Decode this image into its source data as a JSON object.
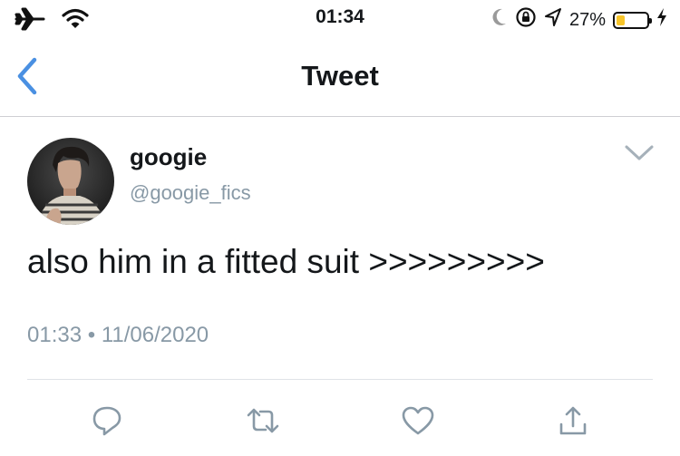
{
  "status_bar": {
    "time": "01:34",
    "battery_percent_label": "27%",
    "battery_level": 0.27,
    "battery_color": "#f7c52a",
    "icons": [
      "airplane-icon",
      "wifi-icon",
      "moon-icon",
      "rotation-lock-icon",
      "location-icon",
      "battery-icon",
      "charging-icon"
    ]
  },
  "nav": {
    "title": "Tweet",
    "back_icon": "chevron-left-icon",
    "accent_color": "#4a90e2"
  },
  "tweet": {
    "display_name": "googie",
    "handle": "@googie_fics",
    "text": "also him in a fitted suit >>>>>>>>>",
    "time": "01:33",
    "separator": "•",
    "date": "11/06/2020",
    "menu_icon": "chevron-down-icon"
  },
  "actions": [
    {
      "name": "reply",
      "icon": "reply-icon"
    },
    {
      "name": "retweet",
      "icon": "retweet-icon"
    },
    {
      "name": "like",
      "icon": "heart-icon"
    },
    {
      "name": "share",
      "icon": "share-icon"
    }
  ]
}
